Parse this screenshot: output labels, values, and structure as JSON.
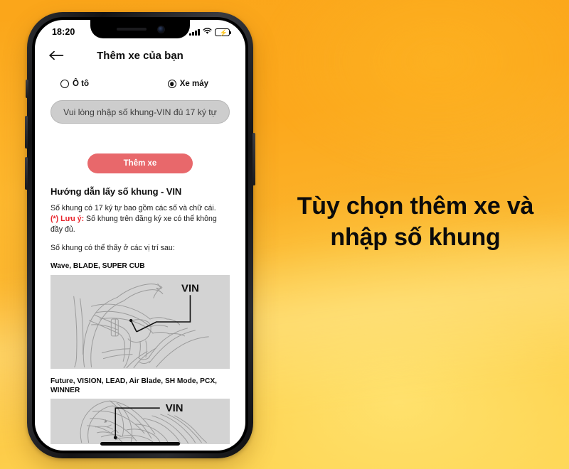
{
  "background": {
    "gradient_from": "#fba61a",
    "gradient_to": "#fcd85b"
  },
  "caption": {
    "line1": "Tùy chọn thêm xe và",
    "line2": "nhập số khung",
    "color": "#0b0b0b"
  },
  "phone": {
    "status_bar": {
      "time": "18:20",
      "signal_icon": "signal-bars-icon",
      "wifi_icon": "wifi-icon",
      "battery_icon": "battery-charging-icon",
      "battery_color": "#f5cf2b"
    },
    "nav": {
      "back_icon": "back-arrow-icon",
      "title": "Thêm xe của bạn"
    },
    "vehicle_type": {
      "options": [
        {
          "label": "Ô tô",
          "selected": false,
          "name": "radio-option-car"
        },
        {
          "label": "Xe máy",
          "selected": true,
          "name": "radio-option-moto"
        }
      ]
    },
    "vin_input": {
      "value": "",
      "placeholder": "Vui lòng nhập số khung-VIN đủ 17 ký tự",
      "background": "#cdcdcd"
    },
    "add_button": {
      "label": "Thêm xe",
      "color": "#e8686b",
      "text_color": "#ffffff"
    },
    "guide": {
      "heading": "Hướng dẫn lấy số khung - VIN",
      "para1": "Số khung có 17 ký tự bao gồm các số và chữ cái.",
      "note_label": "(*) Lưu ý:",
      "note_text": " Số khung trên đăng ký xe có thể không đầy đủ.",
      "note_color": "#e8242b",
      "para_positions": "Số khung có thể thấy ở các vị trí sau:",
      "diagrams": [
        {
          "caption": "Wave, BLADE, SUPER CUB",
          "vin_label": "VIN",
          "image_name": "motorcycle-frame-diagram-wave",
          "background": "#d3d3d3"
        },
        {
          "caption": "Future, VISION, LEAD, Air Blade, SH Mode, PCX, WINNER",
          "vin_label": "VIN",
          "image_name": "motorcycle-frame-diagram-future",
          "background": "#d3d3d3"
        }
      ]
    },
    "home_indicator": "home-indicator"
  }
}
